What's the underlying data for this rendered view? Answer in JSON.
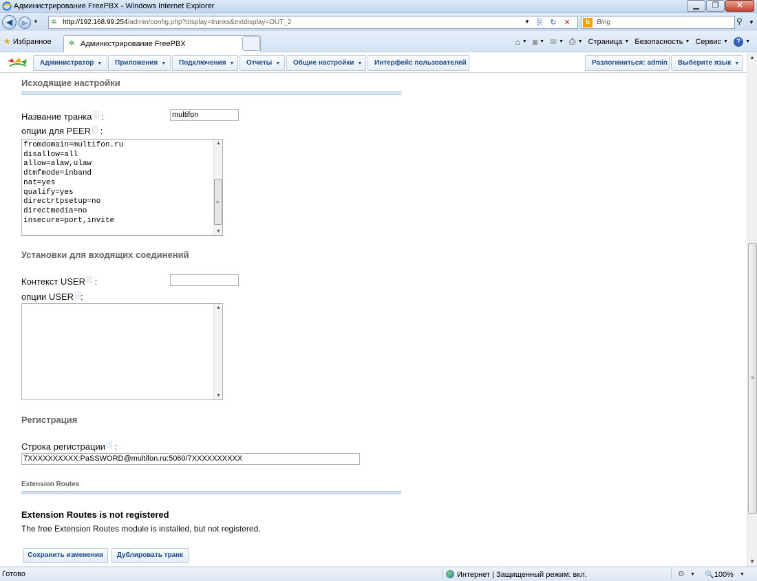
{
  "window": {
    "title": "Администрирование FreePBX - Windows Internet Explorer"
  },
  "addressbar": {
    "url_host": "http://192.168.99.254",
    "url_rest": "/admin/config.php?display=trunks&extdisplay=OUT_2",
    "search_placeholder": "Bing"
  },
  "favorites": {
    "label": "Избранное",
    "tab_label": "Администрирование FreePBX"
  },
  "commandbar": {
    "page": "Страница",
    "security": "Безопасность",
    "service": "Сервис"
  },
  "pbx_menu": {
    "items": [
      "Администратор",
      "Приложения",
      "Подключения",
      "Отчеты",
      "Общие настройки"
    ],
    "user_interface": "Интерфейс пользователей",
    "logout": "Разлогиниться: admin",
    "language": "Выберите язык"
  },
  "outgoing": {
    "section_title": "Исходящие настройки",
    "trunk_name_label": "Название транка",
    "trunk_name_value": "multifon",
    "peer_options_label": "опции для PEER",
    "peer_options_lines": [
      "fromdomain=multifon.ru",
      "disallow=all",
      "allow=alaw,ulaw",
      "dtmfmode=inband",
      "nat=yes",
      "qualify=yes",
      "directrtpsetup=no",
      "directmedia=no",
      "insecure=port,invite"
    ]
  },
  "incoming": {
    "section_title": "Установки для входящих соединений",
    "user_context_label": "Контекст USER",
    "user_context_value": "",
    "user_options_label": "опции USER"
  },
  "registration": {
    "section_title": "Регистрация",
    "reg_string_label": "Строка регистрации",
    "reg_string_value": "7XXXXXXXXXX:PaSSWORD@multifon.ru:5060/7XXXXXXXXXX"
  },
  "extension_routes": {
    "section_title": "Extension Routes",
    "notice_title": "Extension Routes is not registered",
    "notice_text": "The free Extension Routes module is installed, but not registered."
  },
  "buttons": {
    "save": "Сохранить изменения",
    "duplicate": "Дублировать транк"
  },
  "statusbar": {
    "ready": "Готово",
    "zone": "Интернет | Защищенный режим: вкл.",
    "zoom": "100%"
  }
}
